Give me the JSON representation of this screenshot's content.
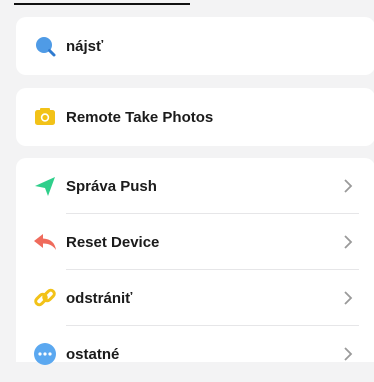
{
  "top_items": {
    "search": {
      "label": "nájsť",
      "icon": "search-icon"
    },
    "remote_photos": {
      "label": "Remote Take Photos",
      "icon": "camera-icon"
    }
  },
  "menu": [
    {
      "label": "Správa Push",
      "icon": "send-icon"
    },
    {
      "label": "Reset Device",
      "icon": "reply-icon"
    },
    {
      "label": "odstrániť",
      "icon": "link-icon"
    },
    {
      "label": "ostatné",
      "icon": "more-icon"
    }
  ],
  "colors": {
    "background": "#f3f3f4",
    "search": "#4f9be6",
    "camera": "#f2c218",
    "send": "#2fcf8b",
    "reset": "#ef6b5c",
    "link": "#f2c218",
    "more": "#5ba8f0",
    "chevron": "#9a9a9a"
  }
}
